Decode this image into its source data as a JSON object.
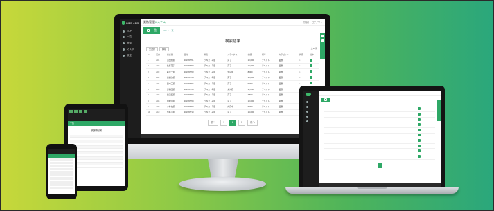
{
  "brand": {
    "logo_text": "WEB APP",
    "accent": "#2ea866"
  },
  "app": {
    "system_title_prefix": "業務管理",
    "system_title_suffix": "システム",
    "user_items": [
      "管理者",
      "ログアウト"
    ]
  },
  "sidebar": {
    "items": [
      {
        "label": "TOP"
      },
      {
        "label": "一覧"
      },
      {
        "label": "登録"
      },
      {
        "label": "マスタ"
      },
      {
        "label": "設定"
      }
    ]
  },
  "page": {
    "badge": "一覧",
    "breadcrumb": "TOP > 一覧",
    "title": "検索結果",
    "tool_buttons": [
      "全選択",
      "解除"
    ],
    "count_text": "全10件"
  },
  "table": {
    "headers": [
      "No",
      "区分",
      "担当者",
      "日付",
      "件名",
      "ステータス",
      "金額",
      "備考",
      "カテゴリー",
      "状態",
      "操作"
    ],
    "rows": [
      [
        "1",
        "A01",
        "山田太郎",
        "2019/05/01",
        "テキスト項目",
        "完了",
        "10,000",
        "テキスト",
        "業務",
        "○",
        ""
      ],
      [
        "2",
        "A02",
        "佐藤花子",
        "2019/05/02",
        "テキスト項目",
        "完了",
        "12,000",
        "テキスト",
        "業務",
        "○",
        ""
      ],
      [
        "3",
        "A03",
        "鈴木一郎",
        "2019/05/03",
        "テキスト項目",
        "対応中",
        "8,000",
        "テキスト",
        "業務",
        "○",
        ""
      ],
      [
        "4",
        "A04",
        "高橋次郎",
        "2019/05/04",
        "テキスト項目",
        "完了",
        "15,000",
        "テキスト",
        "業務",
        "○",
        ""
      ],
      [
        "5",
        "A05",
        "田中三郎",
        "2019/05/05",
        "テキスト項目",
        "完了",
        "9,000",
        "テキスト",
        "業務",
        "○",
        ""
      ],
      [
        "6",
        "A06",
        "伊藤四郎",
        "2019/05/06",
        "テキスト項目",
        "未対応",
        "11,000",
        "テキスト",
        "業務",
        "○",
        ""
      ],
      [
        "7",
        "A07",
        "渡辺五郎",
        "2019/05/07",
        "テキスト項目",
        "完了",
        "7,500",
        "テキスト",
        "業務",
        "○",
        ""
      ],
      [
        "8",
        "A08",
        "中村六郎",
        "2019/05/08",
        "テキスト項目",
        "完了",
        "13,000",
        "テキスト",
        "業務",
        "○",
        ""
      ],
      [
        "9",
        "A09",
        "小林七郎",
        "2019/05/09",
        "テキスト項目",
        "対応中",
        "6,000",
        "テキスト",
        "業務",
        "○",
        ""
      ],
      [
        "10",
        "A10",
        "加藤八郎",
        "2019/05/10",
        "テキスト項目",
        "完了",
        "14,000",
        "テキスト",
        "業務",
        "○",
        ""
      ]
    ]
  },
  "pager": {
    "prev": "前へ",
    "pages": [
      "1",
      "2",
      "3"
    ],
    "current": "2",
    "next": "次へ"
  }
}
